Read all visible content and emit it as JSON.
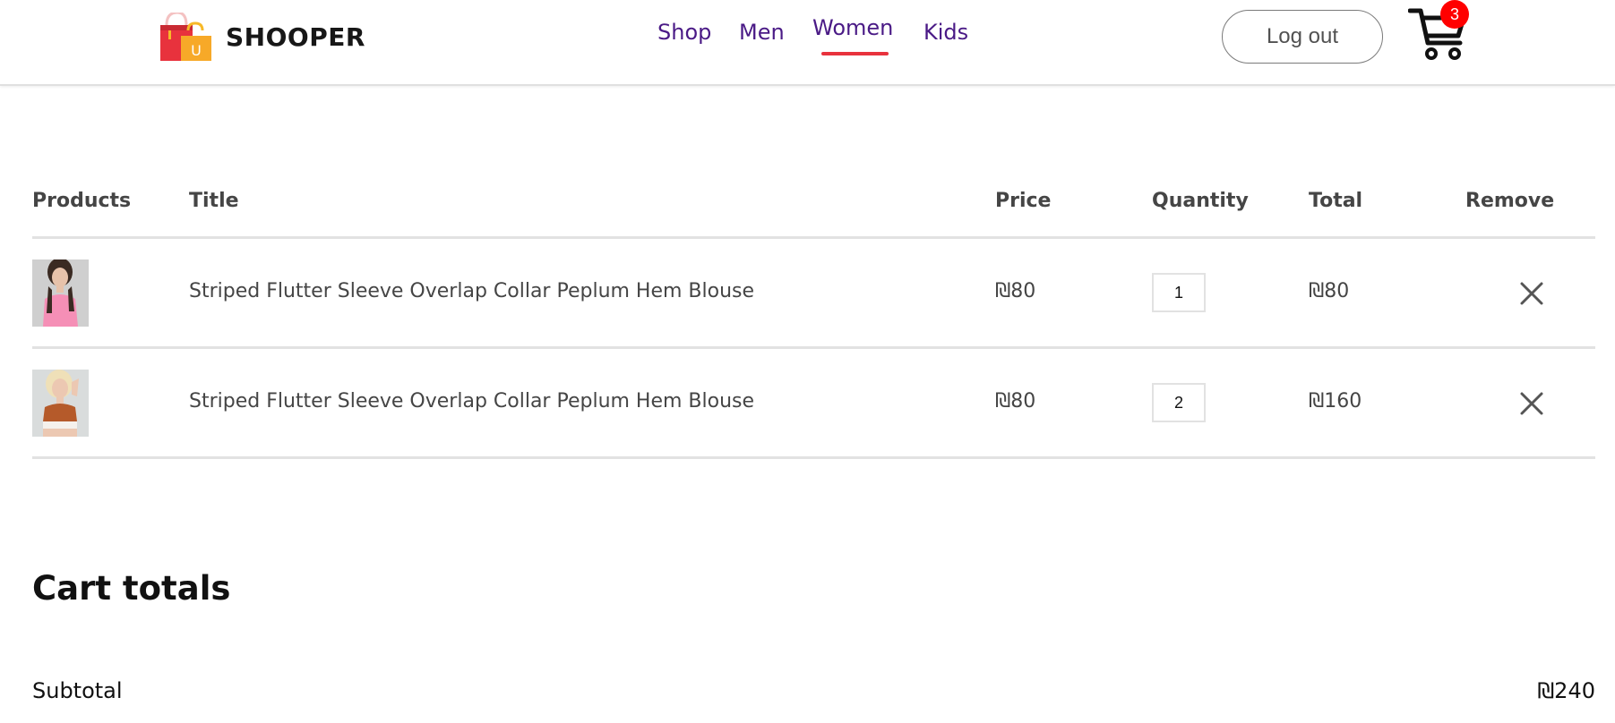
{
  "header": {
    "brand": "SHOOPER",
    "logo_letter": "U",
    "nav": [
      {
        "label": "Shop"
      },
      {
        "label": "Men"
      },
      {
        "label": "Women",
        "active": true
      },
      {
        "label": "Kids"
      }
    ],
    "logout_label": "Log out",
    "cart_count": "3"
  },
  "cart": {
    "columns": [
      "Products",
      "Title",
      "Price",
      "Quantity",
      "Total",
      "Remove"
    ],
    "items": [
      {
        "title": "Striped Flutter Sleeve Overlap Collar Peplum Hem Blouse",
        "price": "₪80",
        "quantity": "1",
        "total": "₪80"
      },
      {
        "title": "Striped Flutter Sleeve Overlap Collar Peplum Hem Blouse",
        "price": "₪80",
        "quantity": "2",
        "total": "₪160"
      }
    ]
  },
  "totals": {
    "title": "Cart totals",
    "subtotal_label": "Subtotal",
    "subtotal_value": "₪240"
  },
  "colors": {
    "nav_text": "#4a1a86",
    "accent": "#e8323d",
    "badge": "#ff0000"
  }
}
